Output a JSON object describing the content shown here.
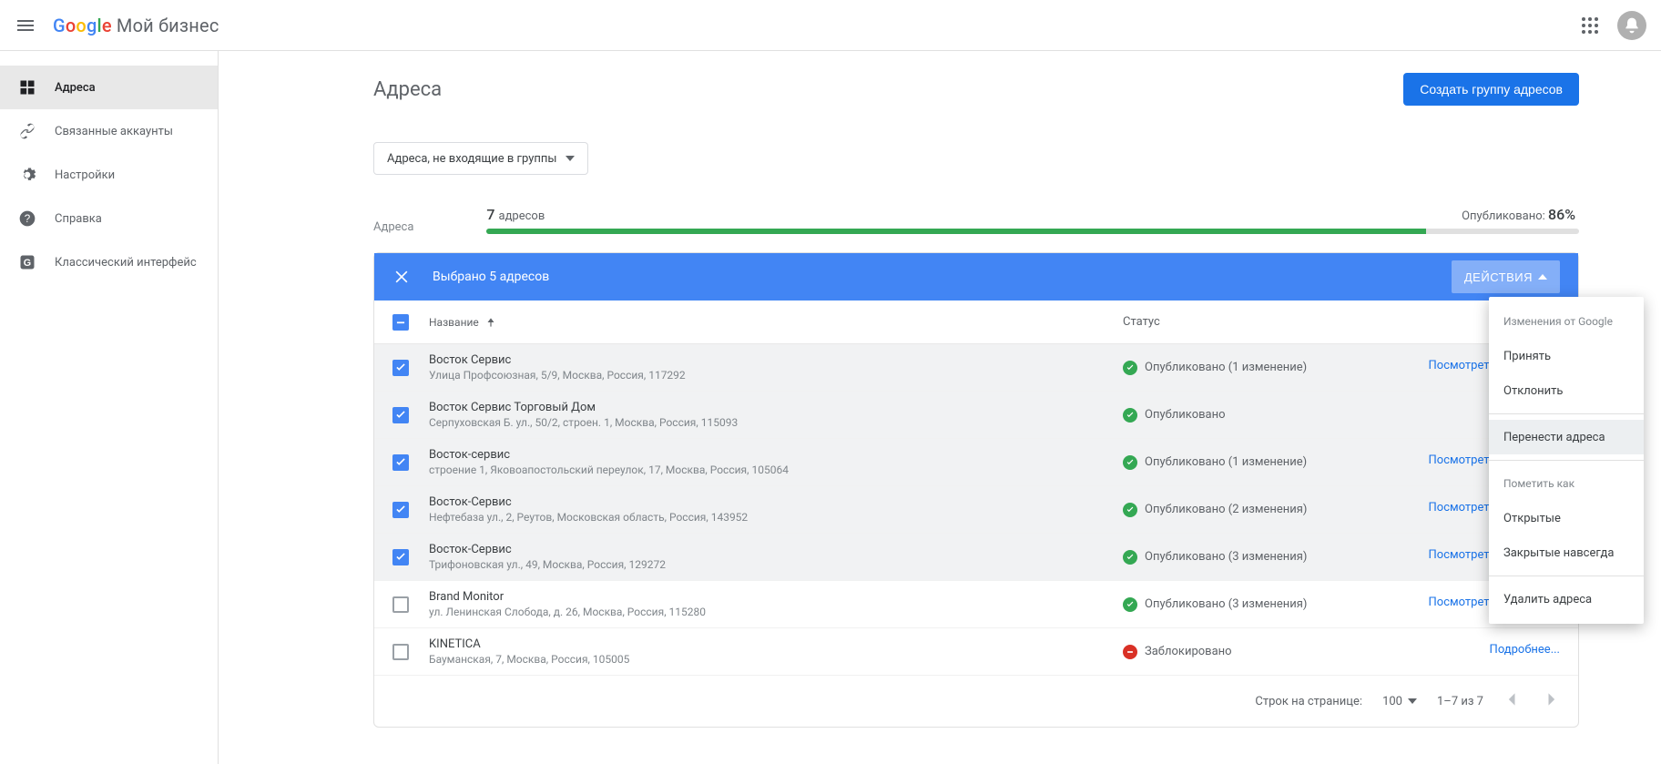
{
  "app": {
    "brand": "Google",
    "product": "Мой бизнес"
  },
  "sidebar": {
    "items": [
      {
        "label": "Адреса",
        "icon": "grid"
      },
      {
        "label": "Связанные аккаунты",
        "icon": "link"
      },
      {
        "label": "Настройки",
        "icon": "gear"
      },
      {
        "label": "Справка",
        "icon": "help"
      },
      {
        "label": "Классический интерфейс",
        "icon": "glogo"
      }
    ]
  },
  "page": {
    "title": "Адреса",
    "create_group_btn": "Создать группу адресов",
    "filter_label": "Адреса, не входящие в группы"
  },
  "stats": {
    "side_label": "Адреса",
    "count_value": "7",
    "count_word": "адресов",
    "pub_label": "Опубликовано:",
    "pub_percent": "86%",
    "progress": 86
  },
  "selection": {
    "text": "Выбрано 5 адресов",
    "actions_btn": "ДЕЙСТВИЯ"
  },
  "columns": {
    "name": "Название",
    "status": "Статус"
  },
  "rows": [
    {
      "checked": true,
      "name": "Восток Сервис",
      "addr": "Улица Профсоюзная, 5/9, Москва, Россия, 117292",
      "status_ok": true,
      "status": "Опубликовано (1 изменение)",
      "action": "Посмотреть изменения"
    },
    {
      "checked": true,
      "name": "Восток Сервис Торговый Дом",
      "addr": "Серпуховская Б. ул., 50/2, строен. 1, Москва, Россия, 115093",
      "status_ok": true,
      "status": "Опубликовано",
      "action": ""
    },
    {
      "checked": true,
      "name": "Восток-сервис",
      "addr": "строение 1, Яковоапостольский переулок, 17, Москва, Россия, 105064",
      "status_ok": true,
      "status": "Опубликовано (1 изменение)",
      "action": "Посмотреть изменения"
    },
    {
      "checked": true,
      "name": "Восток-Сервис",
      "addr": "Нефтебаза ул., 2, Реутов, Московская область, Россия, 143952",
      "status_ok": true,
      "status": "Опубликовано (2 изменения)",
      "action": "Посмотреть изменения"
    },
    {
      "checked": true,
      "name": "Восток-Сервис",
      "addr": "Трифоновская ул., 49, Москва, Россия, 129272",
      "status_ok": true,
      "status": "Опубликовано (3 изменения)",
      "action": "Посмотреть изменения"
    },
    {
      "checked": false,
      "name": "Brand Monitor",
      "addr": "ул. Ленинская Слобода, д. 26, Москва, Россия, 115280",
      "status_ok": true,
      "status": "Опубликовано (3 изменения)",
      "action": "Посмотреть изменения"
    },
    {
      "checked": false,
      "name": "KINETICA",
      "addr": "Бауманская, 7, Москва, Россия, 105005",
      "status_ok": false,
      "status": "Заблокировано",
      "action": "Подробнее..."
    }
  ],
  "menu": {
    "header": "Изменения от Google",
    "items1": [
      "Принять",
      "Отклонить"
    ],
    "highlight": "Перенести адреса",
    "header2": "Пометить как",
    "items2": [
      "Открытые",
      "Закрытые навсегда"
    ],
    "delete": "Удалить адреса"
  },
  "footer": {
    "rows_label": "Строк на странице:",
    "rows_value": "100",
    "range": "1–7 из 7"
  }
}
